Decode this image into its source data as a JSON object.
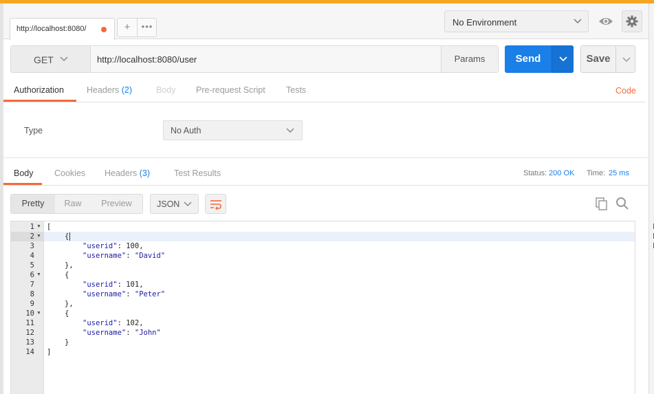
{
  "tab": {
    "title": "http://localhost:8080/",
    "plus": "+",
    "more": "•••"
  },
  "environment": {
    "selected": "No Environment"
  },
  "request": {
    "method": "GET",
    "url": "http://localhost:8080/user",
    "params_label": "Params",
    "send_label": "Send",
    "save_label": "Save"
  },
  "request_tabs": [
    {
      "label": "Authorization",
      "count": ""
    },
    {
      "label": "Headers",
      "count": "(2)"
    },
    {
      "label": "Body",
      "count": ""
    },
    {
      "label": "Pre-request Script",
      "count": ""
    },
    {
      "label": "Tests",
      "count": ""
    }
  ],
  "code_link": "Code",
  "auth": {
    "type_label": "Type",
    "selected": "No Auth"
  },
  "response_tabs": [
    {
      "label": "Body",
      "count": ""
    },
    {
      "label": "Cookies",
      "count": ""
    },
    {
      "label": "Headers",
      "count": "(3)"
    },
    {
      "label": "Test Results",
      "count": ""
    }
  ],
  "status": {
    "label": "Status:",
    "value": "200 OK",
    "time_label": "Time:",
    "time_value": "25 ms"
  },
  "view_options": [
    "Pretty",
    "Raw",
    "Preview"
  ],
  "format": "JSON",
  "response_body": [
    {
      "n": "1",
      "fold": true,
      "indent": 0,
      "parts": [
        [
          "p",
          "["
        ]
      ]
    },
    {
      "n": "2",
      "fold": true,
      "indent": 1,
      "parts": [
        [
          "p",
          "{"
        ]
      ],
      "cursor": true
    },
    {
      "n": "3",
      "fold": false,
      "indent": 2,
      "parts": [
        [
          "k",
          "\"userid\""
        ],
        [
          "p",
          ": "
        ],
        [
          "n",
          "100"
        ],
        [
          "p",
          ","
        ]
      ]
    },
    {
      "n": "4",
      "fold": false,
      "indent": 2,
      "parts": [
        [
          "k",
          "\"username\""
        ],
        [
          "p",
          ": "
        ],
        [
          "s",
          "\"David\""
        ]
      ]
    },
    {
      "n": "5",
      "fold": false,
      "indent": 1,
      "parts": [
        [
          "p",
          "},"
        ]
      ]
    },
    {
      "n": "6",
      "fold": true,
      "indent": 1,
      "parts": [
        [
          "p",
          "{"
        ]
      ]
    },
    {
      "n": "7",
      "fold": false,
      "indent": 2,
      "parts": [
        [
          "k",
          "\"userid\""
        ],
        [
          "p",
          ": "
        ],
        [
          "n",
          "101"
        ],
        [
          "p",
          ","
        ]
      ]
    },
    {
      "n": "8",
      "fold": false,
      "indent": 2,
      "parts": [
        [
          "k",
          "\"username\""
        ],
        [
          "p",
          ": "
        ],
        [
          "s",
          "\"Peter\""
        ]
      ]
    },
    {
      "n": "9",
      "fold": false,
      "indent": 1,
      "parts": [
        [
          "p",
          "},"
        ]
      ]
    },
    {
      "n": "10",
      "fold": true,
      "indent": 1,
      "parts": [
        [
          "p",
          "{"
        ]
      ]
    },
    {
      "n": "11",
      "fold": false,
      "indent": 2,
      "parts": [
        [
          "k",
          "\"userid\""
        ],
        [
          "p",
          ": "
        ],
        [
          "n",
          "102"
        ],
        [
          "p",
          ","
        ]
      ]
    },
    {
      "n": "12",
      "fold": false,
      "indent": 2,
      "parts": [
        [
          "k",
          "\"username\""
        ],
        [
          "p",
          ": "
        ],
        [
          "s",
          "\"John\""
        ]
      ]
    },
    {
      "n": "13",
      "fold": false,
      "indent": 1,
      "parts": [
        [
          "p",
          "}"
        ]
      ]
    },
    {
      "n": "14",
      "fold": false,
      "indent": 0,
      "parts": [
        [
          "p",
          "]"
        ]
      ]
    }
  ],
  "highlighted_line": "2",
  "colors": {
    "accent": "#f26b3a",
    "send": "#1a7fe7",
    "top_bar": "#f5a623",
    "json_key": "#1a1aa6"
  },
  "icons": [
    "close-dot-icon",
    "plus-icon",
    "more-icon",
    "chevron-down-icon",
    "eye-icon",
    "gear-icon",
    "wrap-icon",
    "copy-icon",
    "search-icon"
  ]
}
